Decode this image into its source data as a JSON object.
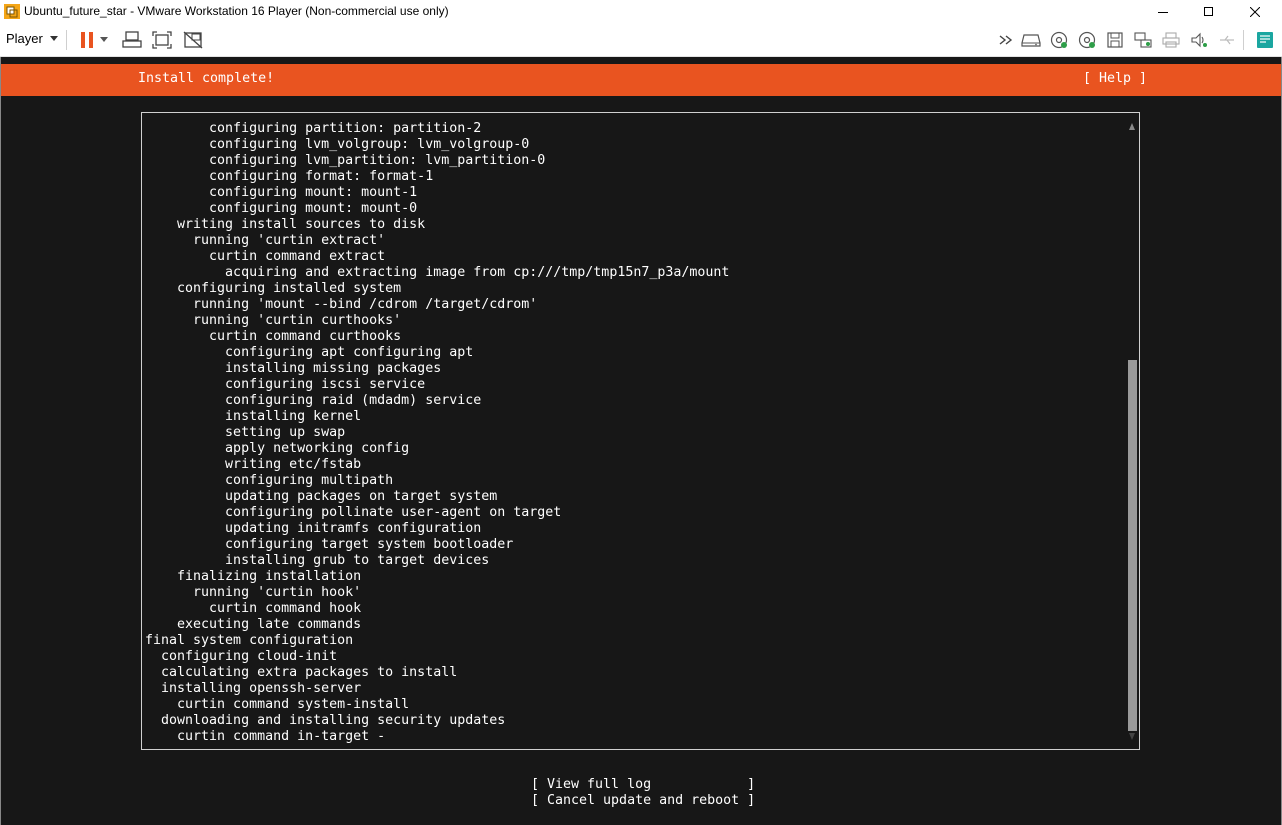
{
  "window": {
    "title": "Ubuntu_future_star - VMware Workstation 16 Player (Non-commercial use only)"
  },
  "toolbar": {
    "player_label": "Player",
    "left_icons": [
      "pause-icon",
      "dropdown-caret-icon",
      "send-ctrl-alt-del-icon",
      "fit-guest-icon",
      "unity-mode-icon"
    ],
    "right_icons": [
      "more-devices-icon",
      "hard-disk-icon",
      "cd-dvd-icon",
      "cd-dvd-2-icon",
      "floppy-icon",
      "network-adapter-icon",
      "printer-icon",
      "sound-card-icon",
      "usb-icon",
      "message-log-icon"
    ]
  },
  "colors": {
    "accent": "#e95420",
    "terminal_bg": "#171717",
    "terminal_fg": "#ffffff"
  },
  "installer": {
    "header_title": "Install complete!",
    "help_label": "[ Help ]",
    "log_lines": [
      "        configuring partition: partition-2",
      "        configuring lvm_volgroup: lvm_volgroup-0",
      "        configuring lvm_partition: lvm_partition-0",
      "        configuring format: format-1",
      "        configuring mount: mount-1",
      "        configuring mount: mount-0",
      "    writing install sources to disk",
      "      running 'curtin extract'",
      "        curtin command extract",
      "          acquiring and extracting image from cp:///tmp/tmp15n7_p3a/mount",
      "    configuring installed system",
      "      running 'mount --bind /cdrom /target/cdrom'",
      "      running 'curtin curthooks'",
      "        curtin command curthooks",
      "          configuring apt configuring apt",
      "          installing missing packages",
      "          configuring iscsi service",
      "          configuring raid (mdadm) service",
      "          installing kernel",
      "          setting up swap",
      "          apply networking config",
      "          writing etc/fstab",
      "          configuring multipath",
      "          updating packages on target system",
      "          configuring pollinate user-agent on target",
      "          updating initramfs configuration",
      "          configuring target system bootloader",
      "          installing grub to target devices",
      "    finalizing installation",
      "      running 'curtin hook'",
      "        curtin command hook",
      "    executing late commands",
      "final system configuration",
      "  configuring cloud-init",
      "  calculating extra packages to install",
      "  installing openssh-server",
      "    curtin command system-install",
      "  downloading and installing security updates",
      "    curtin command in-target -"
    ],
    "buttons": {
      "view_log": "[ View full log            ]",
      "cancel_reboot": "[ Cancel update and reboot ]"
    }
  }
}
